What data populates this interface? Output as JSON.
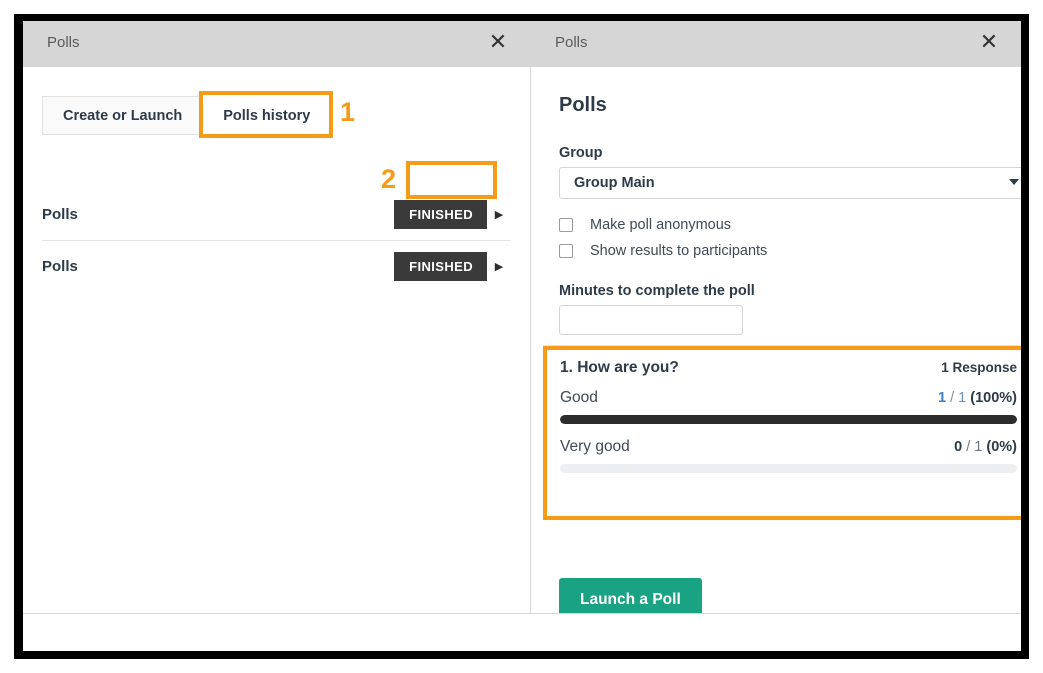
{
  "left_window": {
    "titlebar": {
      "title": "Polls",
      "close_icon": "close-icon"
    },
    "tabs": [
      {
        "label": "Create or Launch",
        "active": false
      },
      {
        "label": "Polls history",
        "active": true
      }
    ],
    "poll_rows": [
      {
        "name": "Polls",
        "status": "FINISHED",
        "caret_icon": "caret-right-icon"
      },
      {
        "name": "Polls",
        "status": "FINISHED",
        "caret_icon": "caret-right-icon"
      }
    ]
  },
  "annotations": {
    "marker_1": "1",
    "marker_2": "2",
    "color": "#f59b18"
  },
  "right_window": {
    "titlebar": {
      "title": "Polls",
      "close_icon": "close-icon"
    },
    "heading": "Polls",
    "group": {
      "label": "Group",
      "selected": "Group Main",
      "caret_icon": "chevron-down-icon"
    },
    "options": [
      {
        "label": "Make poll anonymous",
        "checked": false
      },
      {
        "label": "Show results to participants",
        "checked": false
      }
    ],
    "minutes": {
      "label": "Minutes to complete the poll",
      "value": "",
      "placeholder": ""
    },
    "results": {
      "question": "1. How are you?",
      "responses": "1 Response",
      "answers": [
        {
          "label": "Good",
          "count": "1",
          "separator": " / ",
          "total": "1",
          "percent": "(100%)",
          "fill_pct": 100,
          "count_style": "blue"
        },
        {
          "label": "Very good",
          "count": "0",
          "separator": " / ",
          "total": "1",
          "percent": "(0%)",
          "fill_pct": 0,
          "count_style": "dark"
        }
      ]
    },
    "launch_button": "Launch a Poll"
  },
  "colors": {
    "accent_orange": "#f59b18",
    "teal_button": "#1aa382",
    "badge_dark": "#3a3a3a",
    "bar_fill": "#2c2c2c",
    "count_blue": "#3d7fc1"
  }
}
